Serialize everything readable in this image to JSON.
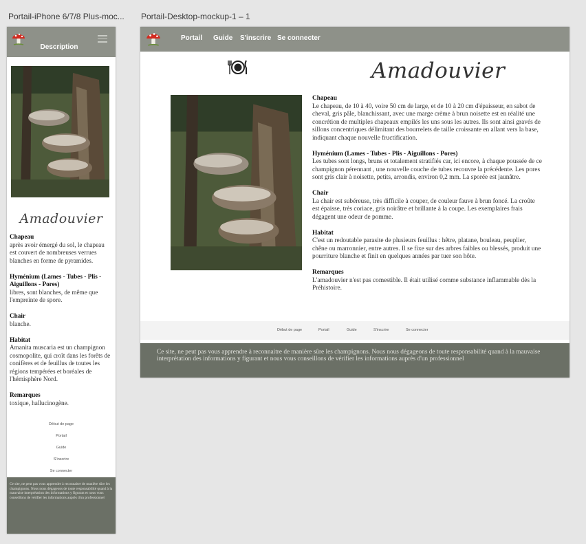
{
  "artboards": {
    "mobile_label": "Portail-iPhone 6/7/8 Plus-moc...",
    "desktop_label": "Portail-Desktop-mockup-1 – 1"
  },
  "mobile": {
    "nav_title": "Description",
    "title": "Amadouvier",
    "sections": [
      {
        "heading": "Chapeau",
        "text": "après avoir émergé du sol, le chapeau est couvert de nombreuses verrues blanches en forme de pyramides."
      },
      {
        "heading": "Hyménium (Lames - Tubes - Plis - Aiguillons - Pores)",
        "text": "libres, sont blanches, de même que l'empreinte de spore."
      },
      {
        "heading": "Chair",
        "text": "blanche."
      },
      {
        "heading": "Habitat",
        "text": "Amanita muscaria est un champignon cosmopolite, qui croît dans les forêts de conifères et de feuillus de toutes les régions tempérées et boréales de l'hémisphère Nord."
      },
      {
        "heading": "Remarques",
        "text": "toxique, hallucinogène."
      }
    ],
    "footer_links": [
      "Début de page",
      "Portail",
      "Guide",
      "S'inscrire",
      "Se connecter"
    ],
    "disclaimer": "Ce site, ne peut pas vous apprendre à reconnaitre de manière sûre les champignons. Nous nous dégageons de toute responsabilité quand à la mauvaise interprétation des informations y figurant et nous vous conseillons de vérifier les informations auprès d'un professionnel"
  },
  "desktop": {
    "nav": [
      "Portail",
      "Guide",
      "S'inscrire",
      "Se connecter"
    ],
    "title": "Amadouvier",
    "sections": [
      {
        "heading": "Chapeau",
        "text": "Le chapeau, de 10 à 40, voire 50 cm de large, et de 10 à 20 cm d'épaisseur, en sabot de cheval, gris pâle, blanchissant, avec une marge crème à brun noisette est en réalité une concrétion de multiples chapeaux empilés les uns sous les autres. Ils sont ainsi gravés de sillons concentriques délimitant des bourrelets de taille croissante en allant vers la base, indiquant chaque nouvelle fructification."
      },
      {
        "heading": "Hyménium (Lames - Tubes - Plis - Aiguillons - Pores)",
        "text": "Les tubes sont longs, bruns et totalement stratifiés car, ici encore, à chaque poussée de ce champignon pérennant , une nouvelle couche de tubes recouvre la précédente. Les pores sont gris clair à noisette, petits, arrondis, environ 0,2 mm. La sporée est jaunâtre."
      },
      {
        "heading": "Chair",
        "text": "La chair est subéreuse, très difficile à couper, de couleur fauve à brun foncé. La croûte est épaisse, très coriace, gris noirâtre et brillante à la coupe. Les exemplaires frais dégagent une odeur de pomme."
      },
      {
        "heading": "Habitat",
        "text": "C'est un redoutable parasite de plusieurs feuillus : hêtre, platane, bouleau, peuplier, chêne ou marronnier, entre autres. Il se fixe sur des arbres faibles ou blessés, produit une pourriture blanche et finit en quelques années par tuer son hôte."
      },
      {
        "heading": "Remarques",
        "text": "L'amadouvier n'est pas comestible. Il était utilisé comme substance inflammable dès la Préhistoire."
      }
    ],
    "footer_links": [
      "Début de page",
      "Portail",
      "Guide",
      "S'inscrire",
      "Se connecter"
    ],
    "disclaimer": "Ce site, ne peut pas vous apprendre à reconnaitre de manière sûre les champignons. Nous nous dégageons de toute responsabilité quand à la mauvaise interprétation des informations y figurant et nous vous conseillons de vérifier les informations auprès d'un professionnel"
  },
  "icons": {
    "logo": "mushroom-logo-icon",
    "menu": "hamburger-menu-icon",
    "edible": "plate-fork-knife-icon"
  },
  "colors": {
    "nav_bar": "#8e9189",
    "footer_bar": "#6b7066",
    "canvas": "#e6e6e6"
  }
}
